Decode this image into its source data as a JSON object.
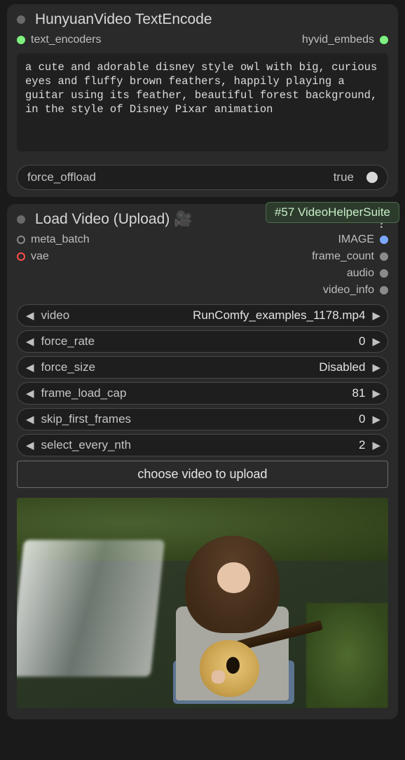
{
  "node1": {
    "title": "HunyuanVideo TextEncode",
    "inputs": [
      {
        "label": "text_encoders",
        "dot": "filled-green"
      }
    ],
    "outputs": [
      {
        "label": "hyvid_embeds",
        "dot": "filled-green"
      }
    ],
    "prompt": "a cute and adorable disney style owl with big, curious eyes and fluffy brown feathers, happily playing a guitar using its feather, beautiful forest background, in the style of Disney Pixar animation",
    "force_offload_label": "force_offload",
    "force_offload_value": "true"
  },
  "badge": "#57 VideoHelperSuite",
  "node2": {
    "title": "Load Video (Upload)",
    "emoji": "🎥",
    "help": "?",
    "inputs": [
      {
        "label": "meta_batch",
        "dot": "open-gray"
      },
      {
        "label": "vae",
        "dot": "open-red"
      }
    ],
    "outputs": [
      {
        "label": "IMAGE",
        "dot": "filled-blue"
      },
      {
        "label": "frame_count",
        "dot": "filled-gray"
      },
      {
        "label": "audio",
        "dot": "filled-gray"
      },
      {
        "label": "video_info",
        "dot": "filled-gray"
      }
    ],
    "params": {
      "video": {
        "label": "video",
        "value": "RunComfy_examples_1178.mp4"
      },
      "force_rate": {
        "label": "force_rate",
        "value": "0"
      },
      "force_size": {
        "label": "force_size",
        "value": "Disabled"
      },
      "frame_load_cap": {
        "label": "frame_load_cap",
        "value": "81"
      },
      "skip_first_frames": {
        "label": "skip_first_frames",
        "value": "0"
      },
      "select_every_nth": {
        "label": "select_every_nth",
        "value": "2"
      }
    },
    "upload_label": "choose video to upload"
  }
}
